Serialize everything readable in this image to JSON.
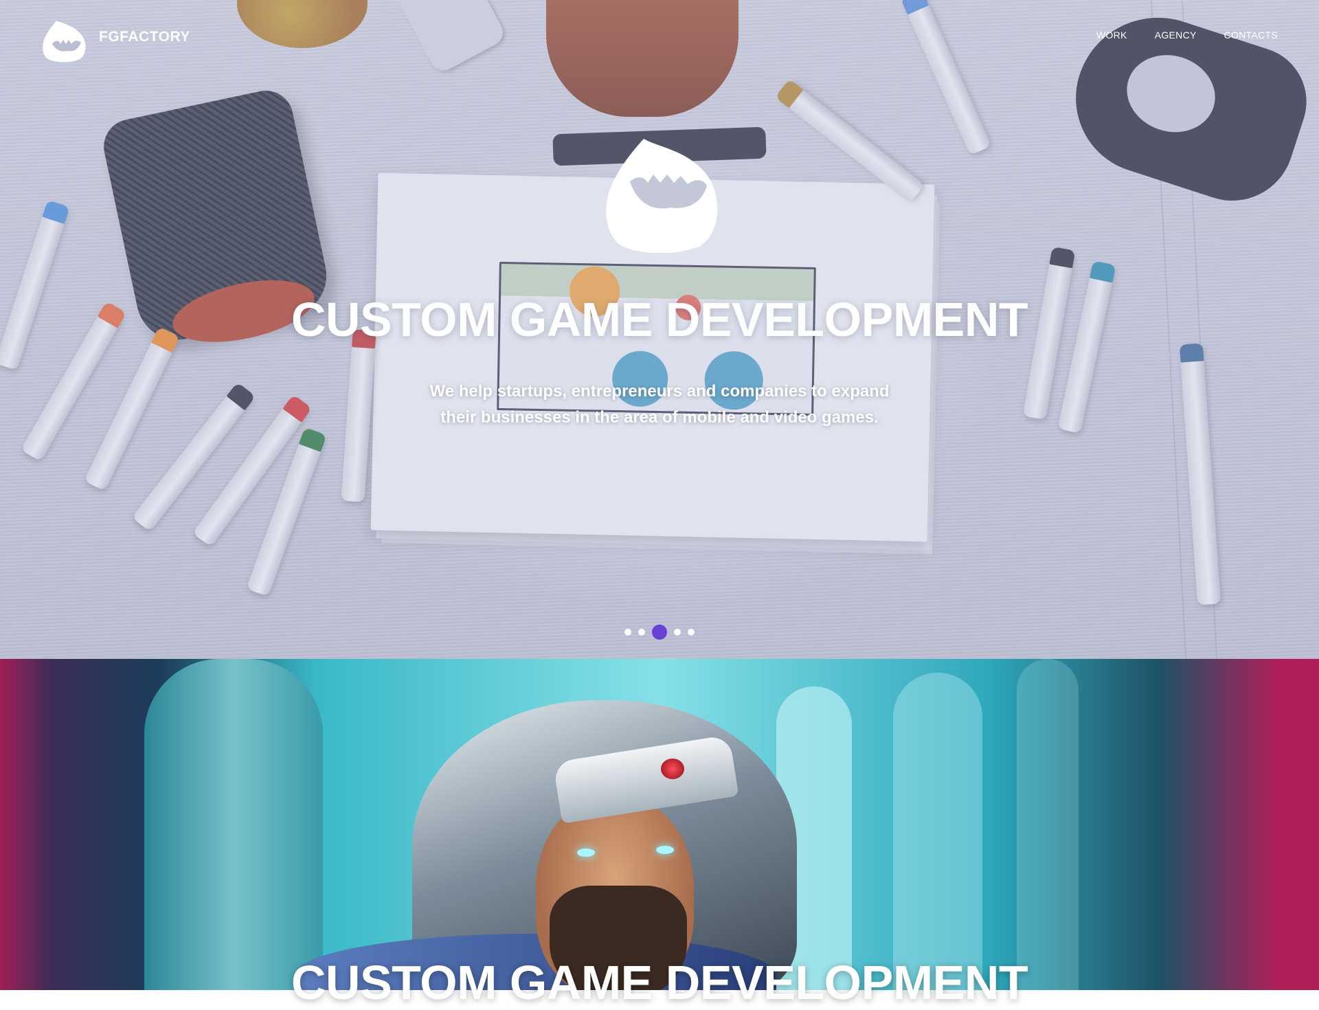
{
  "header": {
    "brand": "FGFACTORY",
    "nav": [
      {
        "label": "WORK"
      },
      {
        "label": "AGENCY"
      },
      {
        "label": "CONTACTS"
      }
    ]
  },
  "hero": {
    "title": "CUSTOM GAME DEVELOPMENT",
    "subtitle": "We help startups, entrepreneurs and companies to expand their businesses in the area of mobile and video games.",
    "slider": {
      "total_slides": 5,
      "active_slide": 3
    }
  },
  "section2": {
    "title": "CUSTOM GAME DEVELOPMENT"
  },
  "colors": {
    "accent": "#6a3fd6",
    "text": "#ffffff"
  },
  "icons": {
    "logo": "fg-mascot-icon",
    "hero_mascot": "fg-mascot-icon"
  }
}
